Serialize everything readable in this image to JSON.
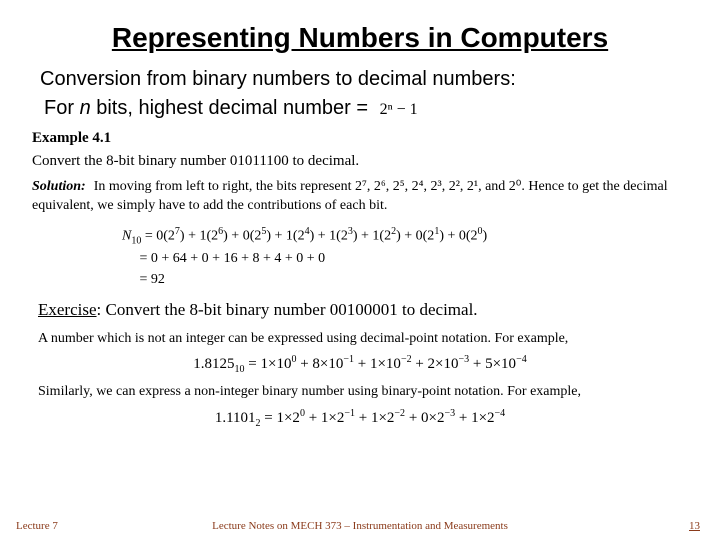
{
  "title": "Representing Numbers in Computers",
  "intro": "Conversion from binary numbers to decimal numbers:",
  "formula": {
    "prefix": "For ",
    "n": "n",
    "mid": " bits, highest decimal number = ",
    "math": "2ⁿ − 1"
  },
  "example": {
    "label": "Example 4.1",
    "prompt": "Convert the 8-bit binary number 01011100 to decimal.",
    "solution_label": "Solution:",
    "solution_text": "In moving from left to right, the bits represent 2⁷, 2⁶, 2⁵, 2⁴, 2³, 2², 2¹, and 2⁰. Hence to get the decimal equivalent, we simply have to add the contributions of each bit.",
    "eq1": "N₁₀ = 0(2⁷) + 1(2⁶) + 0(2⁵) + 1(2⁴) + 1(2³) + 1(2²) + 0(2¹) + 0(2⁰)",
    "eq2": "     = 0 + 64 + 0 + 16 + 8 + 4 + 0 + 0",
    "eq3": "     = 92"
  },
  "exercise": {
    "label": "Exercise",
    "text": ": Convert the 8-bit binary number 00100001 to decimal."
  },
  "para1": "A number which is not an integer can be expressed using decimal-point notation. For example,",
  "eq_decimal": "1.8125₁₀ = 1×10⁰ + 8×10⁻¹ + 1×10⁻² + 2×10⁻³ + 5×10⁻⁴",
  "para2": "Similarly, we can express a non-integer binary number using binary-point notation. For example,",
  "eq_binary": "1.1101₂ = 1×2⁰ + 1×2⁻¹ + 1×2⁻² + 0×2⁻³ + 1×2⁻⁴",
  "footer": {
    "left": "Lecture 7",
    "center": "Lecture Notes on MECH 373 – Instrumentation and Measurements",
    "right": "13"
  }
}
